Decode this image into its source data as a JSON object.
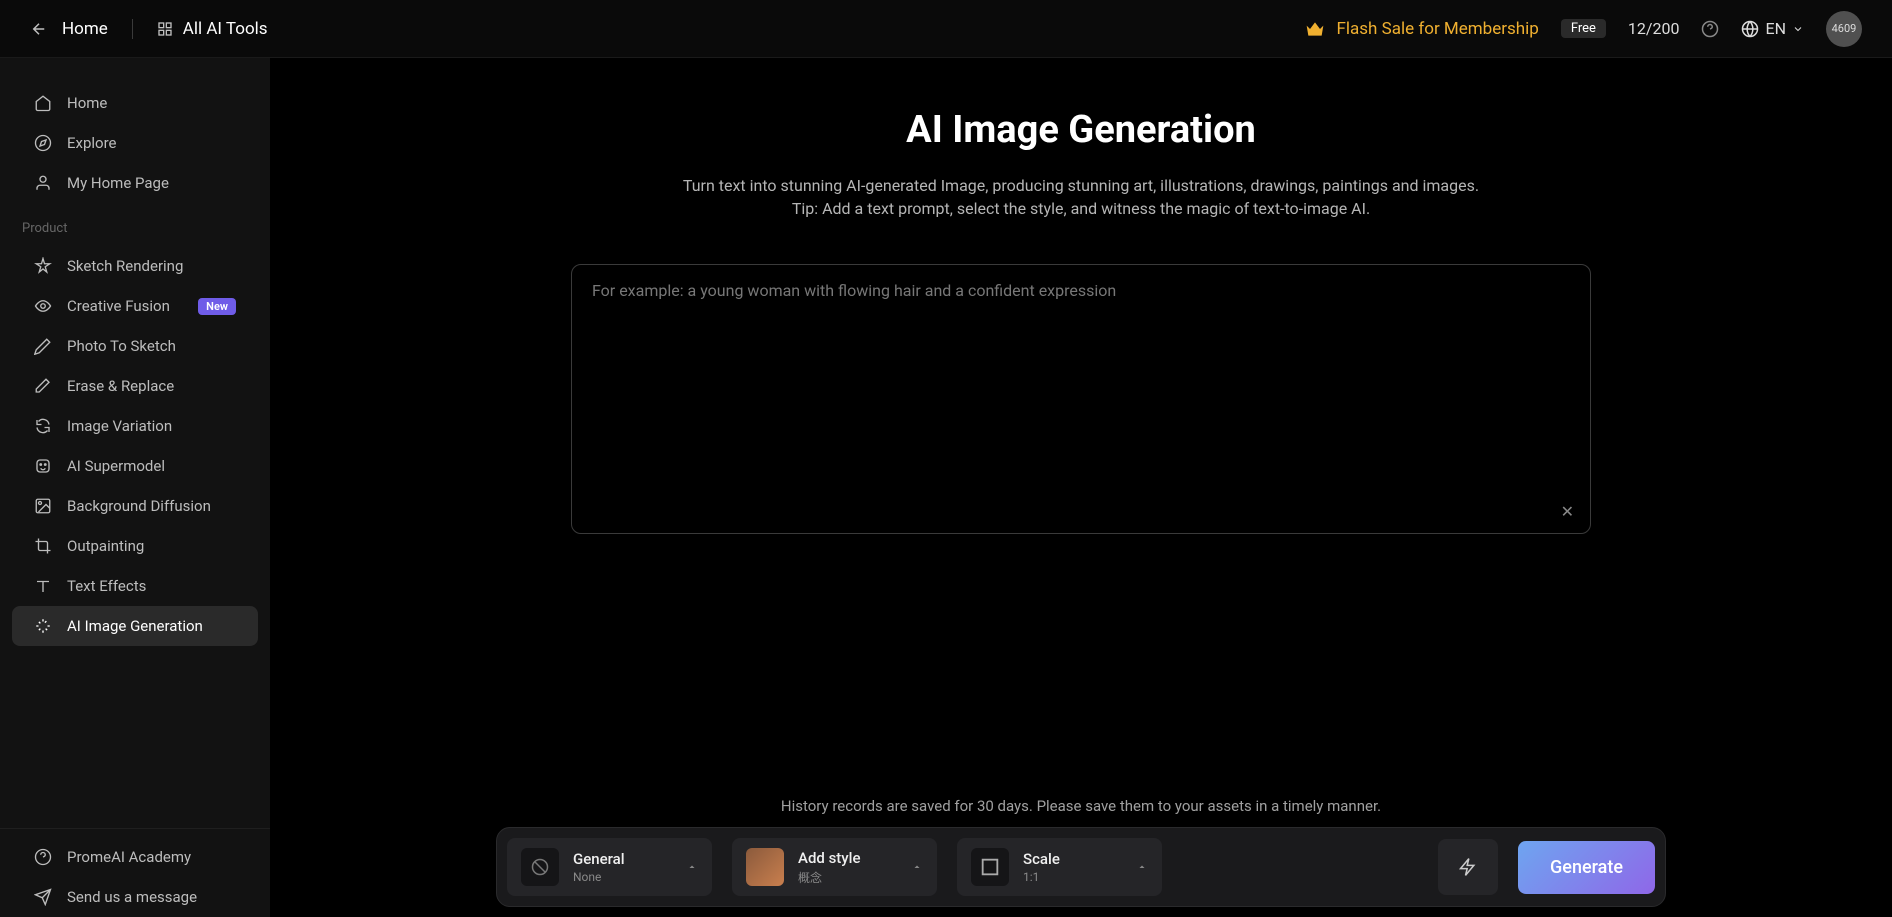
{
  "top_nav": {
    "home": "Home",
    "all_tools": "All AI Tools",
    "flash_sale": "Flash Sale for Membership",
    "free_badge": "Free",
    "credits": "12/200",
    "lang": "EN",
    "avatar": "4609"
  },
  "sidebar": {
    "home": "Home",
    "explore": "Explore",
    "my_home": "My Home Page",
    "section_product": "Product",
    "sketch": "Sketch Rendering",
    "creative_fusion": "Creative Fusion",
    "new_badge": "New",
    "photo_sketch": "Photo To Sketch",
    "erase_replace": "Erase & Replace",
    "image_variation": "Image Variation",
    "ai_supermodel": "AI Supermodel",
    "bg_diffusion": "Background Diffusion",
    "outpainting": "Outpainting",
    "text_effects": "Text Effects",
    "ai_image_gen": "AI Image Generation",
    "academy": "PromeAI Academy",
    "send_message": "Send us a message"
  },
  "main": {
    "title": "AI Image Generation",
    "subtitle1": "Turn text into stunning AI-generated Image, producing stunning art, illustrations, drawings, paintings and images.",
    "subtitle2": "Tip: Add a text prompt, select the style, and witness the magic of text-to-image AI.",
    "placeholder": "For example: a young woman with flowing hair and a confident expression",
    "history_note": "History records are saved for 30 days. Please save them to your assets in a timely manner."
  },
  "options": {
    "general": {
      "title": "General",
      "sub": "None"
    },
    "style": {
      "title": "Add style",
      "sub": "概念"
    },
    "scale": {
      "title": "Scale",
      "sub": "1:1"
    }
  },
  "generate_btn": "Generate"
}
